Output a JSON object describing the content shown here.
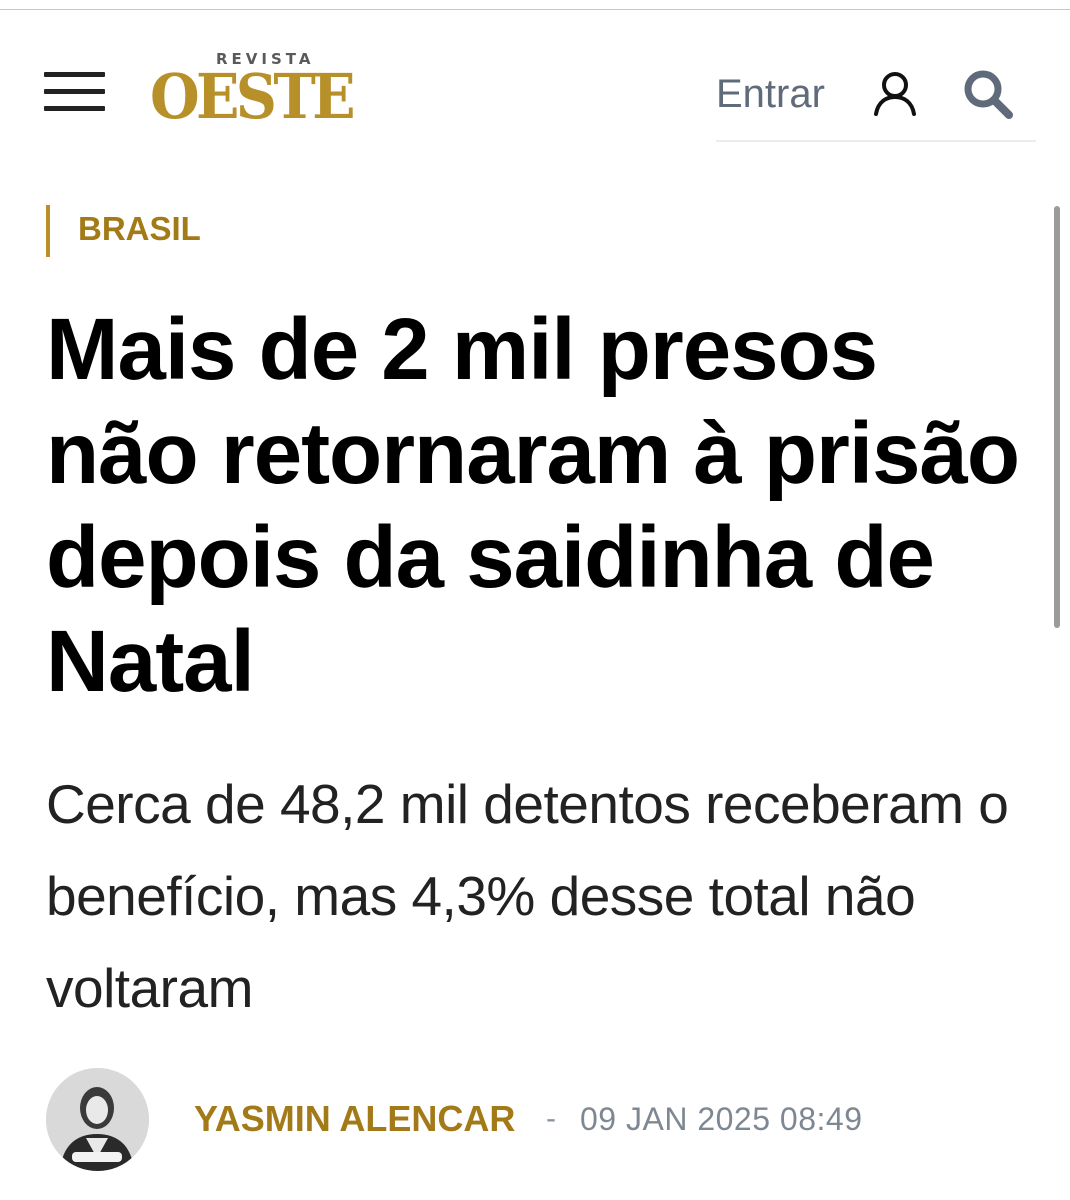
{
  "header": {
    "logo_kicker": "REVISTA",
    "logo_word": "OESTE",
    "login_label": "Entrar",
    "icons": {
      "menu": "hamburger-menu-icon",
      "user": "user-icon",
      "search": "search-icon"
    }
  },
  "article": {
    "category": "BRASIL",
    "headline": "Mais de 2 mil presos não retornaram à prisão depois da saidinha de Natal",
    "subtitle": "Cerca de 48,2 mil detentos receberam o benefício, mas 4,3% desse total não voltaram",
    "author": "YASMIN ALENCAR",
    "separator": "-",
    "published": "09 JAN 2025 08:49"
  },
  "colors": {
    "brand_gold": "#b8902a",
    "category_gold": "#a37a18",
    "muted_gray": "#7e8893",
    "login_gray": "#5f6b7a"
  }
}
